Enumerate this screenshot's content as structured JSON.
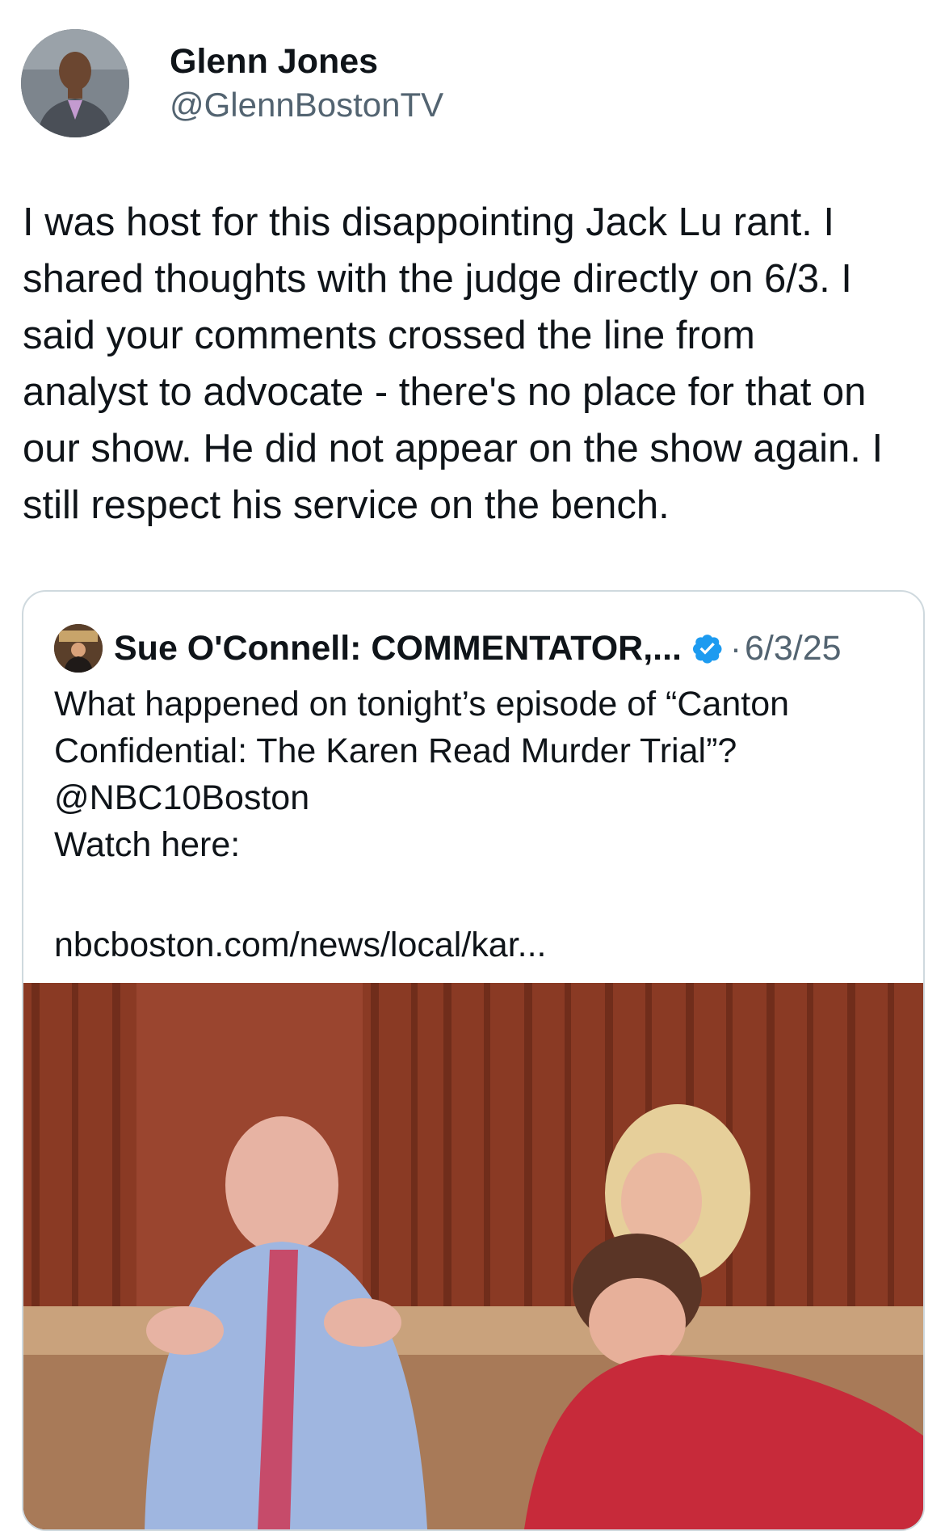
{
  "author": {
    "display_name": "Glenn Jones",
    "handle": "@GlennBostonTV"
  },
  "tweet": {
    "text": "I was host for this disappointing Jack Lu rant. I\nshared thoughts with the judge directly on 6/3. I\nsaid your comments crossed the line from\nanalyst to advocate - there's no place for that on\nour show. He did not appear on the show again. I\nstill respect his service on the bench."
  },
  "quote": {
    "author_name": "Sue O'Connell: COMMENTATOR,...",
    "separator": "·",
    "date": "6/3/25",
    "text": "What happened on tonight’s episode of “Canton\nConfidential: The Karen Read Murder Trial”?\n@NBC10Boston\nWatch here:",
    "link": "nbcboston.com/news/local/kar..."
  },
  "icons": {
    "verified": "verified-badge-icon"
  },
  "colors": {
    "verified_blue": "#1d9bf0",
    "secondary_text": "#536471",
    "border": "#cfd9de"
  }
}
